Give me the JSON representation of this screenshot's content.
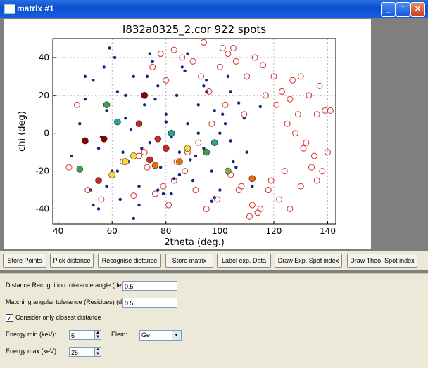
{
  "window": {
    "title": "matrix #1"
  },
  "chart_data": {
    "type": "scatter",
    "title": "I832a0325_2.cor 922 spots",
    "xlabel": "2theta (deg.)",
    "ylabel": "chi (deg)",
    "xlim": [
      38,
      143
    ],
    "ylim": [
      -48,
      50
    ],
    "xticks": [
      40,
      60,
      80,
      100,
      120,
      140
    ],
    "yticks": [
      -40,
      -20,
      0,
      20,
      40
    ],
    "grid": true,
    "series": [
      {
        "marker": "filled-dot",
        "color": "#1a237e",
        "x": [
          45,
          48,
          50,
          52,
          53,
          55,
          57,
          58,
          60,
          62,
          63,
          65,
          66,
          68,
          70,
          72,
          74,
          75,
          77,
          78,
          80,
          82,
          84,
          85,
          87,
          88,
          90,
          92,
          94,
          95,
          97,
          98,
          100,
          102,
          104,
          105,
          55,
          58,
          61,
          64,
          67,
          70,
          73,
          76,
          79,
          82,
          85,
          88,
          91,
          94,
          97,
          100,
          103,
          106,
          109,
          112,
          115,
          50,
          53,
          56,
          59,
          62,
          65,
          68,
          71,
          74,
          77,
          80,
          83,
          86,
          89,
          92,
          95,
          98,
          101,
          104,
          107,
          110
        ],
        "y": [
          -12,
          5,
          18,
          -30,
          28,
          -8,
          35,
          12,
          -20,
          22,
          -35,
          8,
          -15,
          30,
          -28,
          15,
          -5,
          38,
          25,
          -18,
          10,
          -32,
          20,
          -10,
          33,
          5,
          -25,
          15,
          -8,
          28,
          -20,
          12,
          -30,
          5,
          22,
          -15,
          -40,
          -28,
          40,
          -10,
          2,
          -38,
          30,
          18,
          -32,
          -2,
          -22,
          42,
          -12,
          25,
          -36,
          0,
          30,
          -18,
          8,
          -28,
          14,
          30,
          -38,
          -2,
          45,
          -20,
          20,
          -45,
          -8,
          42,
          -30,
          6,
          -24,
          35,
          -14,
          0,
          22,
          -34,
          10,
          -4,
          16,
          -10
        ]
      },
      {
        "marker": "open-circle",
        "color": "#d32f2f",
        "x": [
          44,
          47,
          51,
          56,
          60,
          64,
          68,
          72,
          75,
          78,
          80,
          83,
          86,
          90,
          93,
          96,
          100,
          103,
          106,
          110,
          113,
          116,
          120,
          123,
          126,
          129,
          132,
          135,
          138,
          140,
          118,
          122,
          126,
          130,
          134,
          115,
          112,
          108,
          104,
          99,
          95,
          91,
          87,
          83,
          79,
          76,
          73,
          70,
          125,
          128,
          131,
          136,
          121,
          117,
          109,
          102,
          97,
          92,
          88,
          84,
          81,
          139,
          137,
          133,
          127,
          124,
          119,
          114,
          111,
          107,
          141,
          136,
          130,
          105,
          101,
          94
        ],
        "y": [
          -18,
          15,
          -30,
          -35,
          -22,
          -15,
          -33,
          -10,
          35,
          42,
          28,
          44,
          40,
          38,
          30,
          22,
          35,
          42,
          38,
          30,
          40,
          36,
          30,
          22,
          18,
          10,
          -5,
          -12,
          -20,
          -10,
          -30,
          -35,
          -40,
          -28,
          -18,
          -40,
          -38,
          -28,
          -22,
          -35,
          -40,
          -30,
          -20,
          -25,
          -28,
          -32,
          -18,
          -12,
          5,
          0,
          -8,
          10,
          15,
          20,
          10,
          15,
          5,
          -5,
          -10,
          -15,
          -38,
          12,
          25,
          20,
          28,
          -20,
          -25,
          -42,
          -44,
          -30,
          12,
          -25,
          30,
          45,
          45,
          48
        ]
      },
      {
        "marker": "large-filled",
        "colors": [
          "#8b0000",
          "#c62828",
          "#ef6c00",
          "#fdd835",
          "#43a047",
          "#26a69a",
          "#7cb342"
        ],
        "x": [
          50,
          55,
          72,
          74,
          77,
          57,
          80,
          70,
          76,
          60,
          68,
          58,
          62,
          85,
          88,
          95,
          98,
          48,
          65,
          82,
          112,
          103
        ],
        "y": [
          -4,
          -25,
          20,
          -14,
          -3,
          -3,
          -8,
          5,
          -17,
          -22,
          -12,
          15,
          6,
          -15,
          -8,
          -10,
          -5,
          -19,
          -15,
          0,
          -24,
          -20
        ],
        "color_index": [
          0,
          1,
          0,
          1,
          1,
          0,
          1,
          1,
          2,
          3,
          3,
          4,
          5,
          2,
          3,
          4,
          5,
          4,
          3,
          5,
          2,
          6
        ]
      }
    ]
  },
  "toolbar": {
    "store_points": "Store Points",
    "pick_distance": "Pick distance",
    "recognise_distance": "Recognise distance",
    "store_matrix": "Store matrix",
    "label_exp_data": "Label exp. Data",
    "draw_exp_spot_index": "Draw Exp. Spot index",
    "draw_theo_spot_index": "Draw Theo. Spot index"
  },
  "settings": {
    "distance_tol_label": "Distance Recognition tolerance angle (deg)",
    "distance_tol_value": "0.5",
    "matching_tol_label": "Matching angular tolerance (Residues) (deg)",
    "matching_tol_value": "0.5",
    "closest_label": "Consider only closest distance",
    "closest_checked": "✓",
    "energy_min_label": "Energy min (keV):",
    "energy_min_value": "5",
    "energy_max_label": "Energy max (keV):",
    "energy_max_value": "25",
    "elem_label": "Elem:",
    "elem_value": "Ge"
  }
}
